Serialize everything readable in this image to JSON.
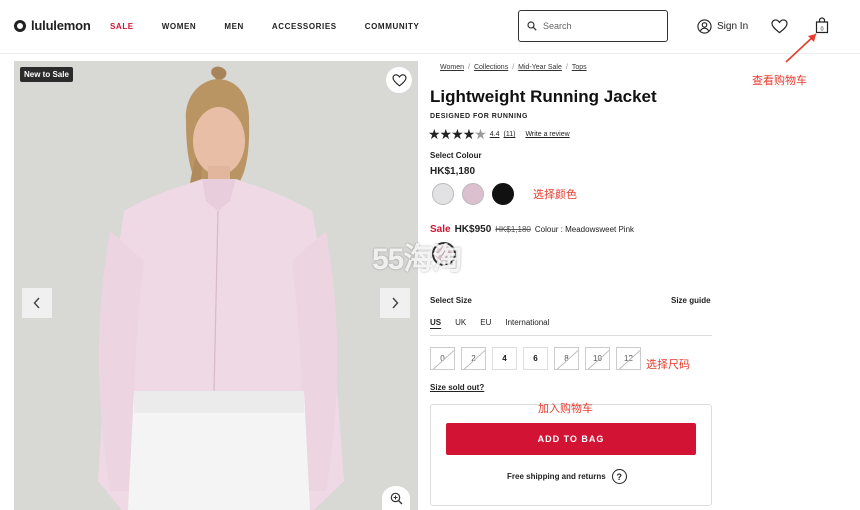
{
  "header": {
    "logo": "lululemon",
    "nav": [
      {
        "label": "SALE",
        "accent": "#d31334"
      },
      {
        "label": "WOMEN"
      },
      {
        "label": "MEN"
      },
      {
        "label": "ACCESSORIES"
      },
      {
        "label": "COMMUNITY"
      }
    ],
    "search_placeholder": "Search",
    "signin_label": "Sign In",
    "bag_count": "0",
    "icons": [
      "search-icon",
      "user-icon",
      "heart-icon",
      "bag-icon"
    ]
  },
  "gallery": {
    "badge": "New to Sale",
    "icons": [
      "heart-icon",
      "chevron-left-icon",
      "chevron-right-icon",
      "zoom-icon"
    ]
  },
  "breadcrumb": [
    "Women",
    "Collections",
    "Mid-Year Sale",
    "Tops"
  ],
  "product": {
    "title": "Lightweight Running Jacket",
    "designed_for": "DESIGNED FOR RUNNING",
    "rating": {
      "stars": 4.4,
      "value": "4.4",
      "count": "(11)",
      "write_review": "Write a review"
    },
    "select_colour_label": "Select Colour",
    "price": "HK$1,180",
    "colours": [
      "#e2e2e4",
      "#dcc0cf",
      "#111111"
    ],
    "sale": {
      "label": "Sale",
      "now": "HK$950",
      "was": "HK$1,180",
      "colour_text": "Colour : Meadowsweet Pink",
      "swatch": "#e6cfda"
    },
    "select_size_label": "Select Size",
    "size_guide": "Size guide",
    "regions": [
      "US",
      "UK",
      "EU",
      "International"
    ],
    "sizes": [
      {
        "label": "0",
        "available": false
      },
      {
        "label": "2",
        "available": false
      },
      {
        "label": "4",
        "available": true
      },
      {
        "label": "6",
        "available": true
      },
      {
        "label": "8",
        "available": false
      },
      {
        "label": "10",
        "available": false
      },
      {
        "label": "12",
        "available": false
      }
    ],
    "sold_out_link": "Size sold out?",
    "add_to_bag": "ADD TO BAG",
    "shipping": "Free shipping and returns",
    "help_icon_text": "?"
  },
  "annotations": {
    "cart": "查看购物车",
    "colour": "选择颜色",
    "size": "选择尺码",
    "add": "加入购物车"
  },
  "watermark": "55海淘"
}
